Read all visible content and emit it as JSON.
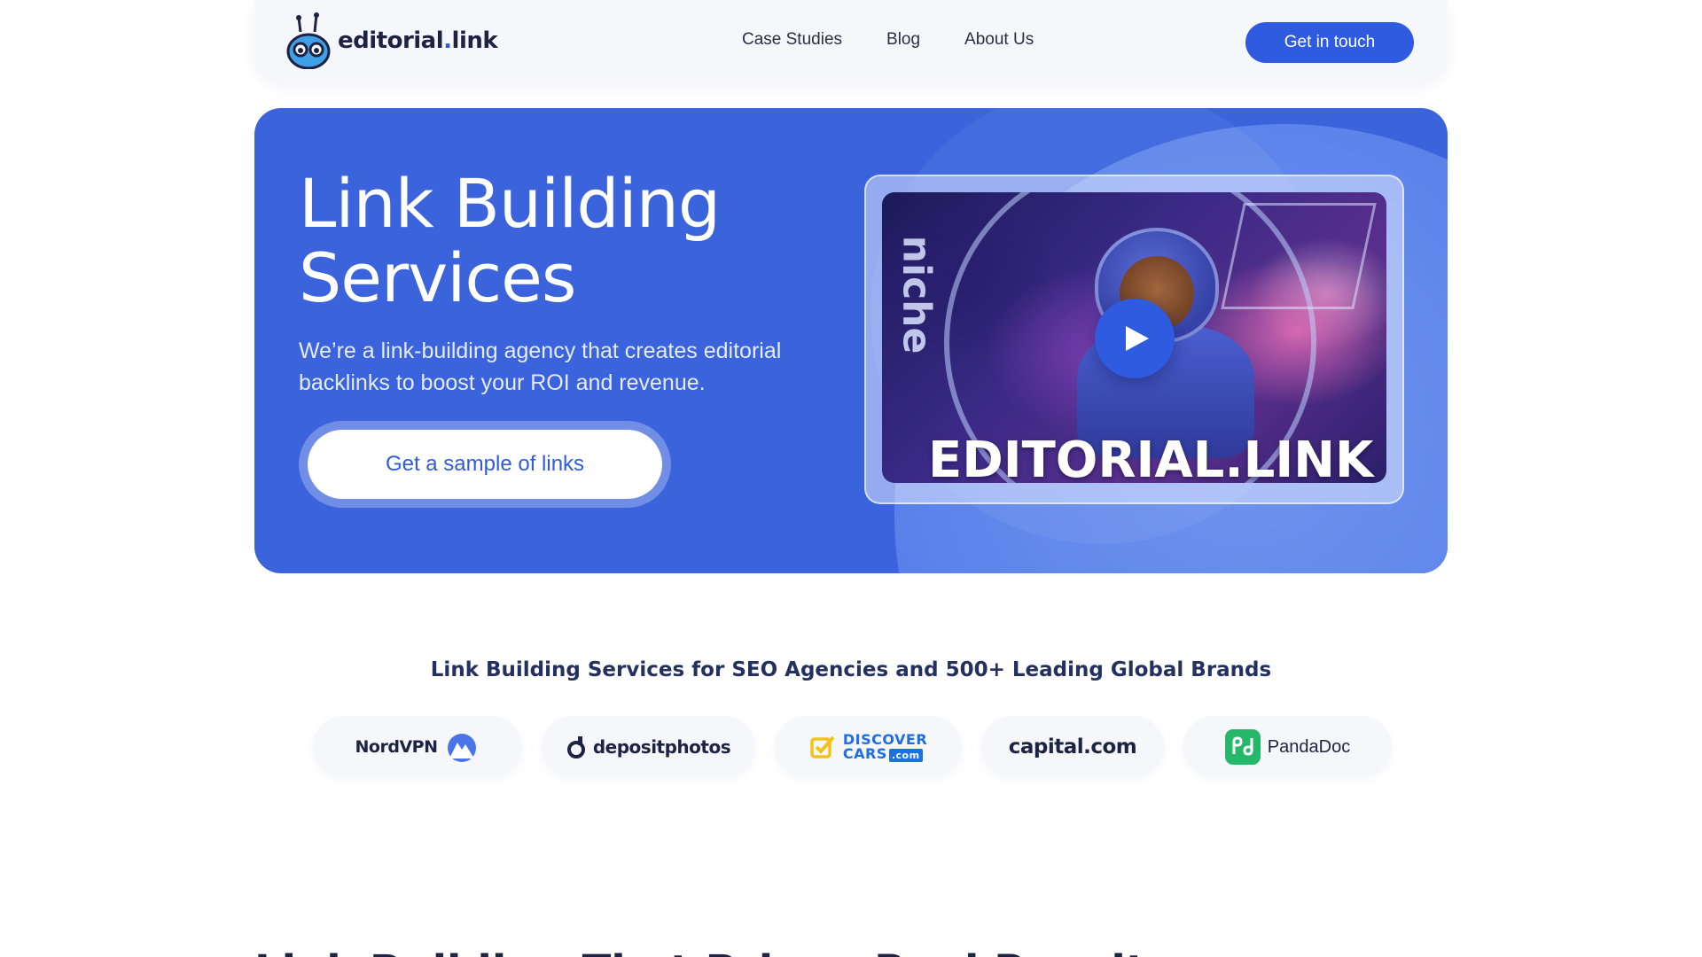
{
  "nav": {
    "brand_name": "editorial",
    "brand_dot": ".",
    "brand_tld": "link",
    "links": [
      "Case Studies",
      "Blog",
      "About Us"
    ],
    "cta_label": "Get in touch"
  },
  "hero": {
    "title_line1": "Link Building",
    "title_line2": "Services",
    "subtitle": "We’re a link-building agency that creates editorial backlinks to boost your ROI and revenue.",
    "cta_label": "Get a sample of links",
    "video": {
      "caption": "EDITORIAL.LINK",
      "side_text": "niche",
      "play_icon": "play-icon"
    }
  },
  "brands": {
    "title": "Link Building Services for SEO Agencies and 500+ Leading Global Brands",
    "items": [
      {
        "name": "NordVPN",
        "icon": "nordvpn-mountain-icon"
      },
      {
        "name": "depositphotos",
        "icon": "depositphotos-drop-icon"
      },
      {
        "name_line1": "DISCOVER",
        "name_line2": "CARS",
        "name_suffix": ".com",
        "icon": "discovercars-check-icon"
      },
      {
        "name": "capital.com",
        "icon": ""
      },
      {
        "name": "PandaDoc",
        "icon": "pandadoc-pd-icon"
      }
    ]
  },
  "next_section": {
    "heading": "Link Building That Brings Real Results"
  },
  "colors": {
    "accent": "#2f5be0",
    "hero_bg": "#3a63dc",
    "text_dark": "#1d2342"
  }
}
